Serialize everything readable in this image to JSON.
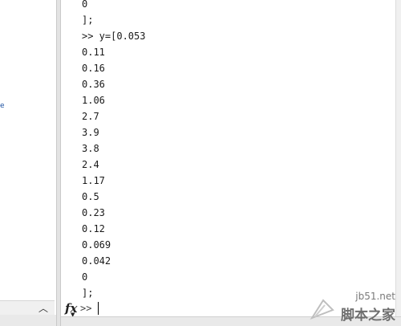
{
  "left_panel": {
    "glyph": "e"
  },
  "console": {
    "lines": [
      "0",
      "];",
      ">> y=[0.053",
      "0.11",
      "0.16",
      "0.36",
      "1.06",
      "2.7",
      "3.9",
      "3.8",
      "2.4",
      "1.17",
      "0.5",
      "0.23",
      "0.12",
      "0.069",
      "0.042",
      "0",
      "];"
    ],
    "prompt_icon": "fx",
    "prompt": ">>"
  },
  "watermark": {
    "url": "jb51.net",
    "site_name": "脚本之家"
  },
  "icons": [
    "fx-icon",
    "scroll-up-arrow-icon",
    "watermark-logo-icon"
  ]
}
